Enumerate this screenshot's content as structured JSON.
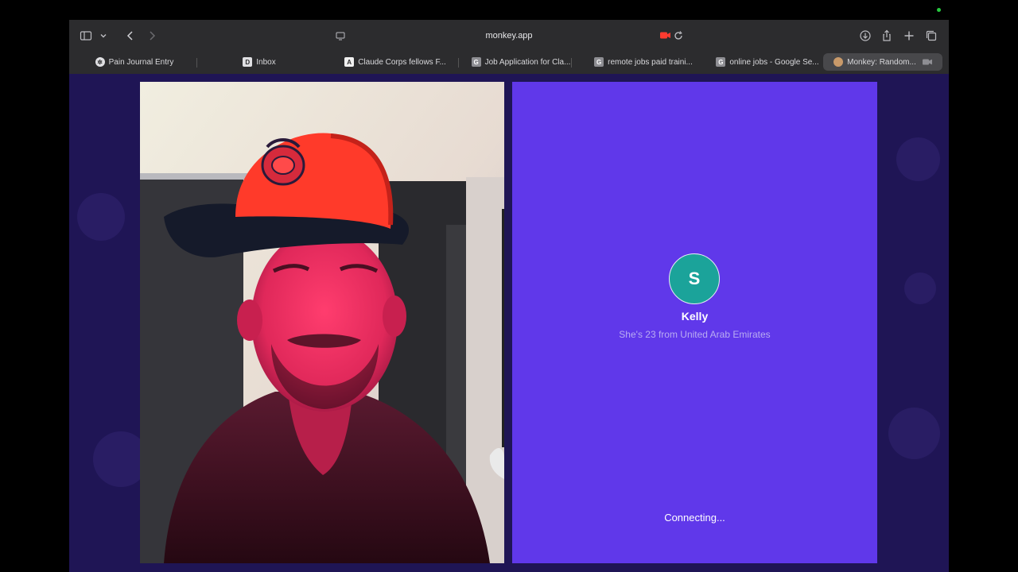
{
  "browser": {
    "url": "monkey.app",
    "tabs": [
      {
        "label": "Pain Journal Entry",
        "favicon": "gear-like"
      },
      {
        "label": "Inbox",
        "favicon": "D"
      },
      {
        "label": "Claude Corps fellows F...",
        "favicon": "A"
      },
      {
        "label": "Job Application for Cla...",
        "favicon": "G"
      },
      {
        "label": "remote jobs paid traini...",
        "favicon": "G"
      },
      {
        "label": "online jobs - Google Se...",
        "favicon": "G"
      },
      {
        "label": "Monkey: Random...",
        "favicon": "monkey",
        "active": true
      }
    ]
  },
  "partner": {
    "avatar_letter": "S",
    "name": "Kelly",
    "info": "She's 23 from United Arab Emirates",
    "status": "Connecting..."
  },
  "colors": {
    "accent": "#6038ea",
    "avatar_bg": "#1ba39a",
    "page_bg": "#1f1555"
  }
}
